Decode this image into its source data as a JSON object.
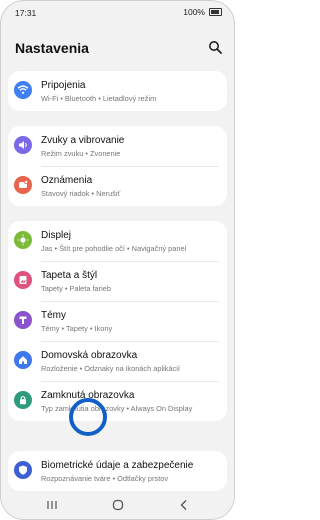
{
  "status": {
    "time": "17:31",
    "battery": "100%"
  },
  "header": {
    "title": "Nastavenia"
  },
  "items": [
    {
      "name": "Pripojenia",
      "sub": "Wi‑Fi  •  Bluetooth  •  Lietadlový režim",
      "icon": "wifi-icon",
      "color": "#3f7ef5"
    },
    {
      "name": "Zvuky a vibrovanie",
      "sub": "Režim zvuku  •  Zvonenie",
      "icon": "sound-icon",
      "color": "#7a68e8"
    },
    {
      "name": "Oznámenia",
      "sub": "Stavový riadok  •  Nerušiť",
      "icon": "notification-icon",
      "color": "#e8644e"
    },
    {
      "name": "Displej",
      "sub": "Jas  •  Štít pre pohodlie očí  •  Navigačný panel",
      "icon": "display-icon",
      "color": "#7cbb3a"
    },
    {
      "name": "Tapeta a štýl",
      "sub": "Tapety  •  Paleta farieb",
      "icon": "wallpaper-icon",
      "color": "#e0527d"
    },
    {
      "name": "Témy",
      "sub": "Témy  •  Tapety  •  Ikony",
      "icon": "themes-icon",
      "color": "#8a55cc"
    },
    {
      "name": "Domovská obrazovka",
      "sub": "Rozloženie  •  Odznaky na ikonách aplikácií",
      "icon": "home-icon",
      "color": "#3e78ee"
    },
    {
      "name": "Zamknutá obrazovka",
      "sub": "Typ zamknutia obrazovky  •  Always On Display",
      "icon": "lock-icon",
      "color": "#2e9b7d"
    },
    {
      "name": "Biometrické údaje a zabezpečenie",
      "sub": "Rozpoznávanie tváre  •  Odtlačky prstov",
      "icon": "shield-icon",
      "color": "#3d5fd6"
    }
  ]
}
